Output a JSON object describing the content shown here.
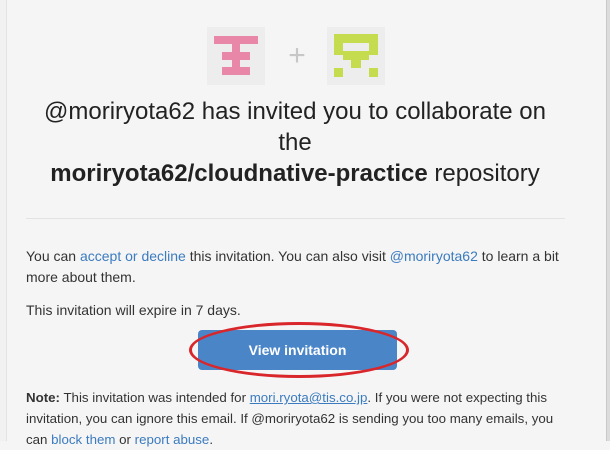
{
  "avatars": {
    "left_user_icon": "identicon-pink",
    "right_user_icon": "identicon-lime",
    "separator": "+"
  },
  "headline": {
    "line1": "@moriryota62 has invited you to collaborate on",
    "line2": "the",
    "repo": "moriryota62/cloudnative-practice",
    "suffix": " repository"
  },
  "body": {
    "p1_a": "You can ",
    "accept_decline_link": "accept or decline",
    "p1_b": " this invitation. You can also visit ",
    "profile_link": "@moriryota62",
    "p1_c": " to learn a bit more about them.",
    "expire": "This invitation will expire in 7 days."
  },
  "button": {
    "label": "View invitation"
  },
  "note": {
    "label": "Note:",
    "a": " This invitation was intended for ",
    "email_link": "mori.ryota@tis.co.jp",
    "b": ". If you were not expecting this invitation, you can ignore this email. If @moriryota62 is sending you too many emails, you can ",
    "block_link": "block them",
    "c": " or ",
    "report_link": "report abuse",
    "d": "."
  },
  "colors": {
    "link": "#3b7bbf",
    "button": "#4a86c7",
    "annotation_circle": "#d9262b",
    "identicon_pink": "#e887a8",
    "identicon_lime": "#c4dc4e"
  }
}
